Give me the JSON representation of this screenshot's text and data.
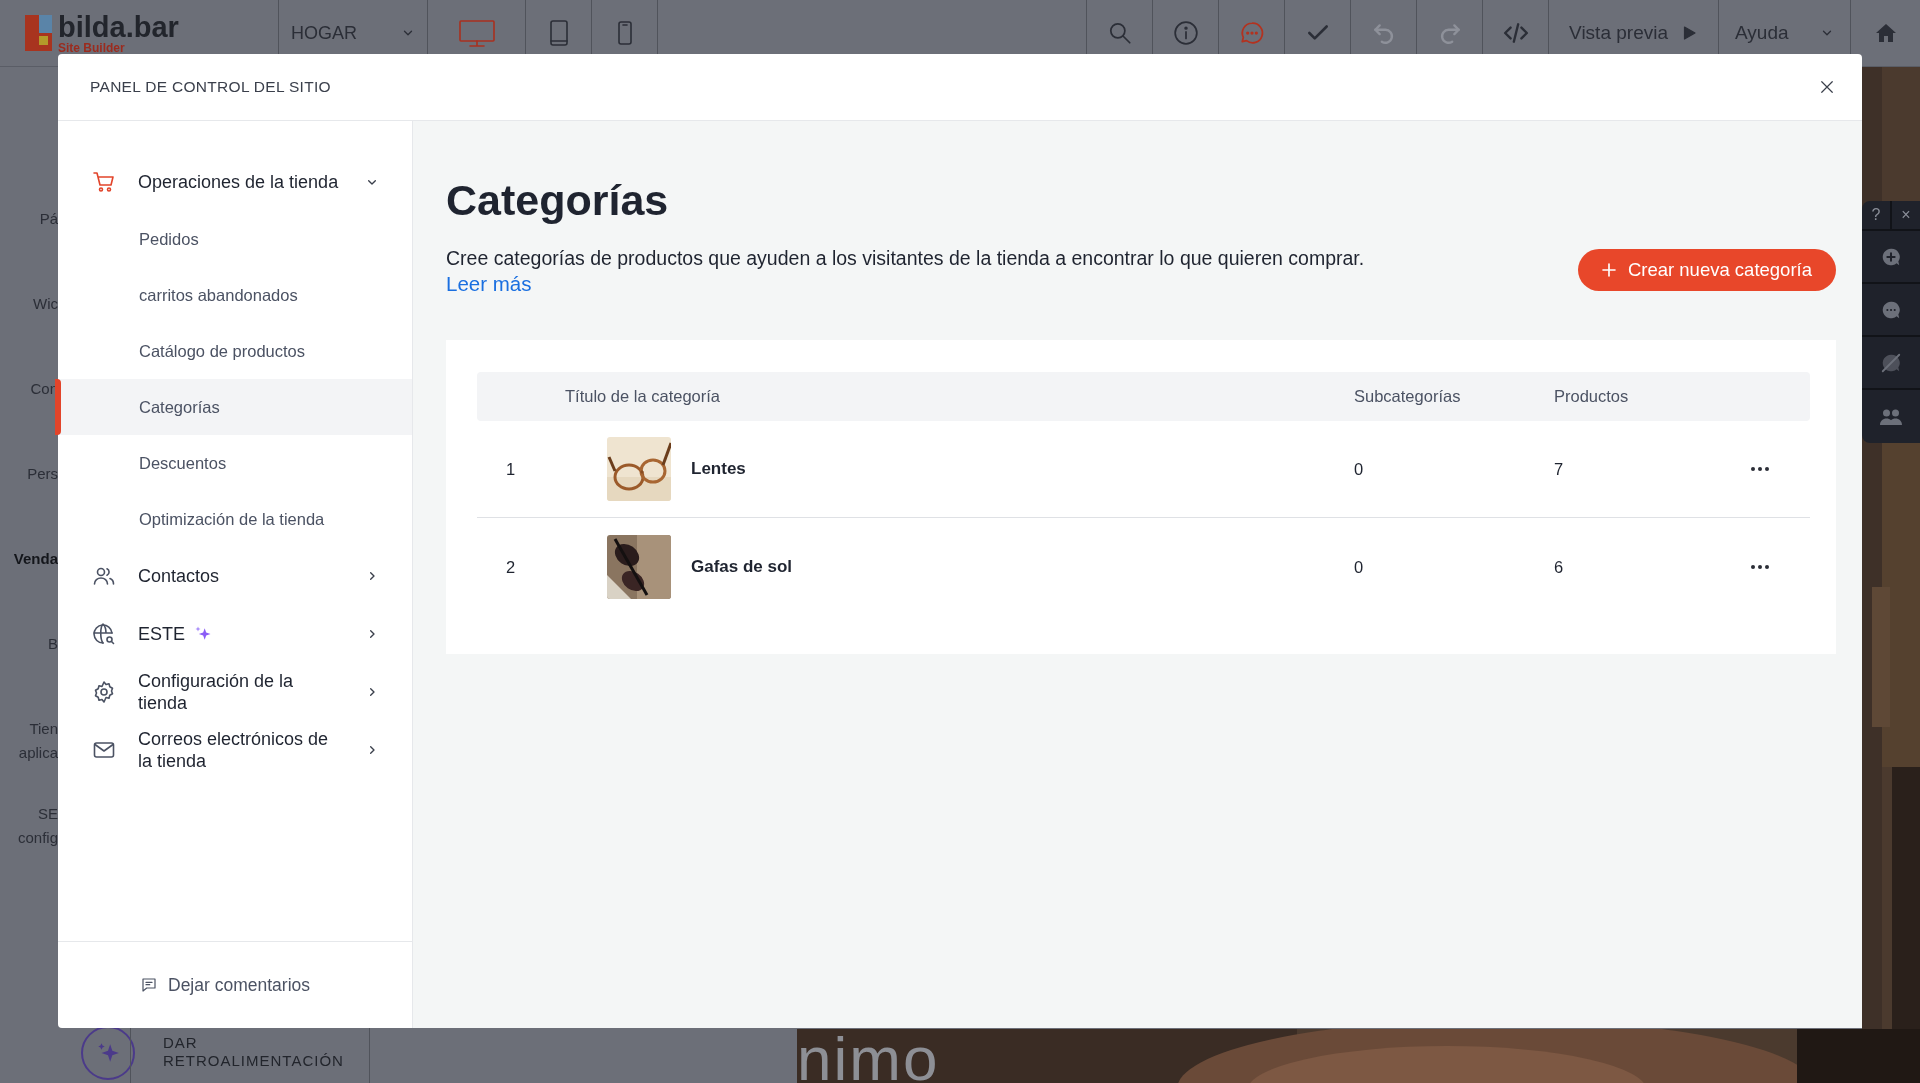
{
  "topbar": {
    "logo_name": "bilda.bar",
    "logo_tagline": "Site Builder",
    "page_selector": "HOGAR",
    "devices": [
      {
        "kind": "desktop",
        "selected": true
      },
      {
        "kind": "tablet",
        "selected": false
      },
      {
        "kind": "mobile",
        "selected": false
      }
    ],
    "tools": [
      {
        "kind": "search",
        "disabled": false
      },
      {
        "kind": "info",
        "disabled": false
      },
      {
        "kind": "comments",
        "disabled": false
      },
      {
        "kind": "check",
        "disabled": false
      },
      {
        "kind": "undo",
        "disabled": true
      },
      {
        "kind": "redo",
        "disabled": true
      },
      {
        "kind": "code",
        "disabled": false
      }
    ],
    "preview": "Vista previa",
    "help": "Ayuda"
  },
  "left_rail": [
    {
      "lines": [
        "Pá"
      ],
      "selected": false
    },
    {
      "lines": [
        "Wic"
      ],
      "selected": false
    },
    {
      "lines": [
        "Con"
      ],
      "selected": false
    },
    {
      "lines": [
        "Pers"
      ],
      "selected": false
    },
    {
      "lines": [
        "Venda"
      ],
      "selected": true
    },
    {
      "lines": [
        "B"
      ],
      "selected": false
    },
    {
      "lines": [
        "Tien",
        "aplica"
      ],
      "selected": false
    },
    {
      "lines": [
        "SE",
        "config"
      ],
      "selected": false
    }
  ],
  "feedback_label": "DAR RETROALIMENTACIÓN",
  "site_heading": "nimo",
  "right_toolbar": {
    "help": "?",
    "close": "×"
  },
  "modal": {
    "title": "PANEL DE CONTROL DEL SITIO",
    "sidebar": [
      {
        "kind": "cart",
        "label": "Operaciones de la tienda",
        "expanded": true,
        "sparkle": false,
        "children": [
          {
            "label": "Pedidos",
            "selected": false
          },
          {
            "label": "carritos abandonados",
            "selected": false
          },
          {
            "label": "Catálogo de productos",
            "selected": false
          },
          {
            "label": "Categorías",
            "selected": true
          },
          {
            "label": "Descuentos",
            "selected": false
          },
          {
            "label": "Optimización de la tienda",
            "selected": false
          }
        ]
      },
      {
        "kind": "contacts",
        "label": "Contactos",
        "expanded": false,
        "sparkle": false
      },
      {
        "kind": "globe",
        "label": "ESTE",
        "expanded": false,
        "sparkle": true
      },
      {
        "kind": "settings",
        "label": "Configuración de la tienda",
        "expanded": false,
        "sparkle": false
      },
      {
        "kind": "mail",
        "label": "Correos electrónicos de la tienda",
        "expanded": false,
        "sparkle": false
      }
    ],
    "footer_link": "Dejar comentarios",
    "heading": "Categorías",
    "description": "Cree categorías de productos que ayuden a los visitantes de la tienda a encontrar lo que quieren comprar.",
    "link": "Leer más",
    "create_button": "Crear nueva categoría",
    "table": {
      "columns": [
        "Título de la categoría",
        "Subcategorías",
        "Productos"
      ],
      "rows": [
        {
          "index": "1",
          "title": "Lentes",
          "subcategories": "0",
          "products": "7"
        },
        {
          "index": "2",
          "title": "Gafas de sol",
          "subcategories": "0",
          "products": "6"
        }
      ]
    }
  }
}
